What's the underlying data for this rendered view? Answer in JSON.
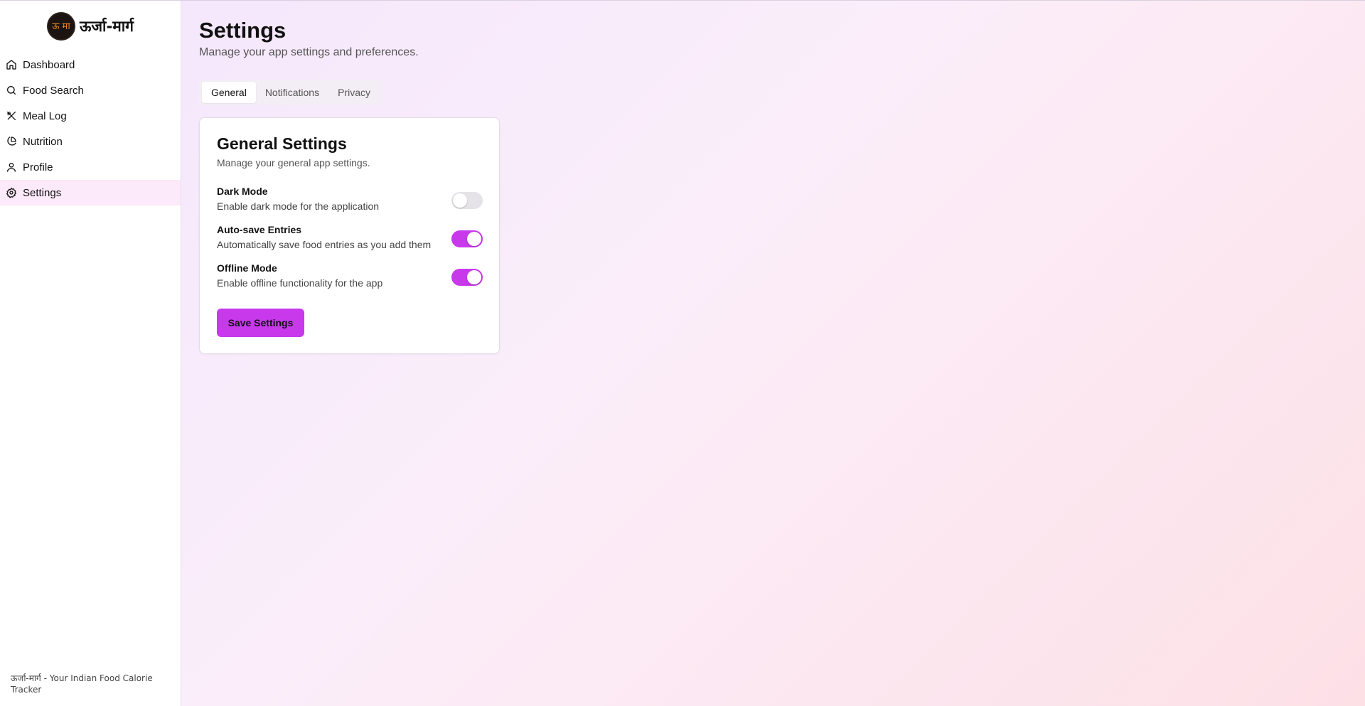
{
  "brand": {
    "logo_text": "ऊ मा",
    "name": "ऊर्जा-मार्ग"
  },
  "sidebar": {
    "items": [
      {
        "label": "Dashboard",
        "icon": "home-icon"
      },
      {
        "label": "Food Search",
        "icon": "search-icon"
      },
      {
        "label": "Meal Log",
        "icon": "utensils-icon"
      },
      {
        "label": "Nutrition",
        "icon": "pie-chart-icon"
      },
      {
        "label": "Profile",
        "icon": "user-icon"
      },
      {
        "label": "Settings",
        "icon": "gear-icon",
        "active": true
      }
    ],
    "footer": "ऊर्जा-मार्ग - Your Indian Food Calorie Tracker"
  },
  "page": {
    "title": "Settings",
    "subtitle": "Manage your app settings and preferences."
  },
  "tabs": [
    {
      "label": "General",
      "active": true
    },
    {
      "label": "Notifications"
    },
    {
      "label": "Privacy"
    }
  ],
  "card": {
    "title": "General Settings",
    "subtitle": "Manage your general app settings.",
    "settings": [
      {
        "label": "Dark Mode",
        "description": "Enable dark mode for the application",
        "enabled": false
      },
      {
        "label": "Auto-save Entries",
        "description": "Automatically save food entries as you add them",
        "enabled": true
      },
      {
        "label": "Offline Mode",
        "description": "Enable offline functionality for the app",
        "enabled": true
      }
    ],
    "save_label": "Save Settings"
  },
  "colors": {
    "accent": "#c839ec",
    "active_nav_bg": "#fce9f9",
    "toggle_off": "#e6e3e8"
  }
}
